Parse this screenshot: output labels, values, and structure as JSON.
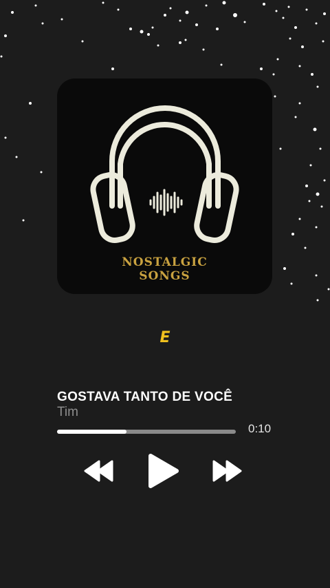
{
  "cover": {
    "icon": "headphones-icon",
    "line1": "NOSTALGIC",
    "line2": "SONGS",
    "accent_color": "#c9a240"
  },
  "lyric": {
    "text": "E",
    "color": "#f0c01e"
  },
  "track": {
    "title": "GOSTAVA TANTO DE VOCÊ",
    "artist": "Tim",
    "elapsed": "0:10",
    "progress_fraction": 0.39
  },
  "controls": {
    "rewind_icon": "rewind-icon",
    "play_icon": "play-icon",
    "forward_icon": "fast-forward-icon"
  }
}
